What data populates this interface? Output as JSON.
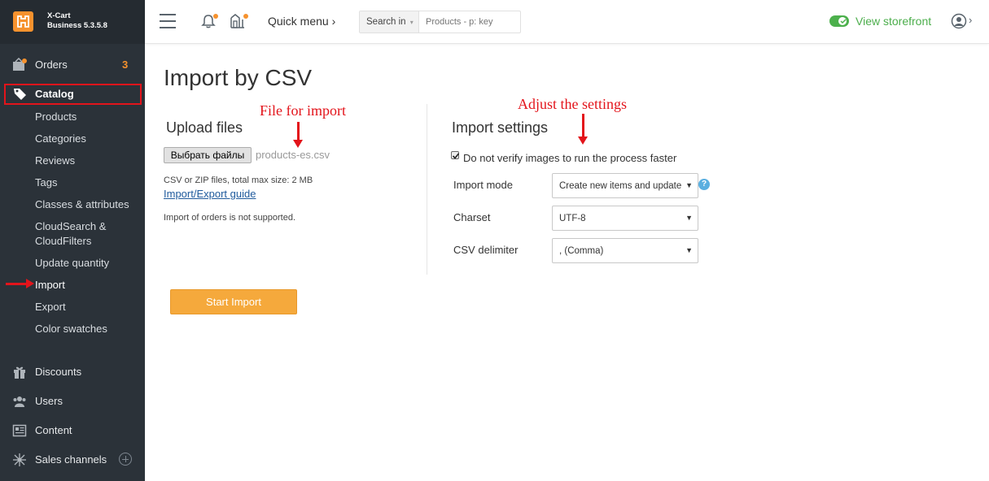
{
  "brand": {
    "line1": "X-Cart",
    "line2": "Business 5.3.5.8",
    "logo_icon": "xcart-logo-icon",
    "logo_color": "#f6922e"
  },
  "sidebar": {
    "orders": {
      "label": "Orders",
      "badge": "3",
      "icon": "orders-icon"
    },
    "catalog": {
      "label": "Catalog",
      "icon": "tag-icon"
    },
    "catalog_items": [
      "Products",
      "Categories",
      "Reviews",
      "Tags",
      "Classes & attributes",
      "CloudSearch &",
      "CloudFilters",
      "Update quantity",
      "Import",
      "Export",
      "Color swatches"
    ],
    "discounts": {
      "label": "Discounts",
      "icon": "gift-icon"
    },
    "users": {
      "label": "Users",
      "icon": "users-icon"
    },
    "content": {
      "label": "Content",
      "icon": "content-icon"
    },
    "sales_channels": {
      "label": "Sales channels",
      "icon": "network-icon"
    }
  },
  "topbar": {
    "quick_menu": "Quick menu ›",
    "search_in": "Search in",
    "search_placeholder": "Products - p: key",
    "view_storefront": "View storefront",
    "user_chevron": "›"
  },
  "page": {
    "title": "Import by CSV",
    "upload": {
      "heading": "Upload files",
      "file_button": "Выбрать файлы",
      "file_name": "products-es.csv",
      "note": "CSV or ZIP files, total max size: 2 MB",
      "guide_link": "Import/Export guide",
      "orders_note": "Import of orders is not supported."
    },
    "settings": {
      "heading": "Import settings",
      "checkbox_label": "Do not verify images to run the process faster",
      "checkbox_checked": true,
      "import_mode_label": "Import mode",
      "import_mode_value": "Create new items and update",
      "charset_label": "Charset",
      "charset_value": "UTF-8",
      "delimiter_label": "CSV delimiter",
      "delimiter_value": ", (Comma)"
    },
    "start_button": "Start Import"
  },
  "annotations": {
    "file_for_import": "File for import",
    "adjust_settings": "Adjust the settings"
  },
  "colors": {
    "sidebar_bg": "#2b3239",
    "accent": "#f6922e",
    "annotation": "#e3141b",
    "storefront_green": "#4cae4c",
    "start_button": "#f5a93c"
  }
}
